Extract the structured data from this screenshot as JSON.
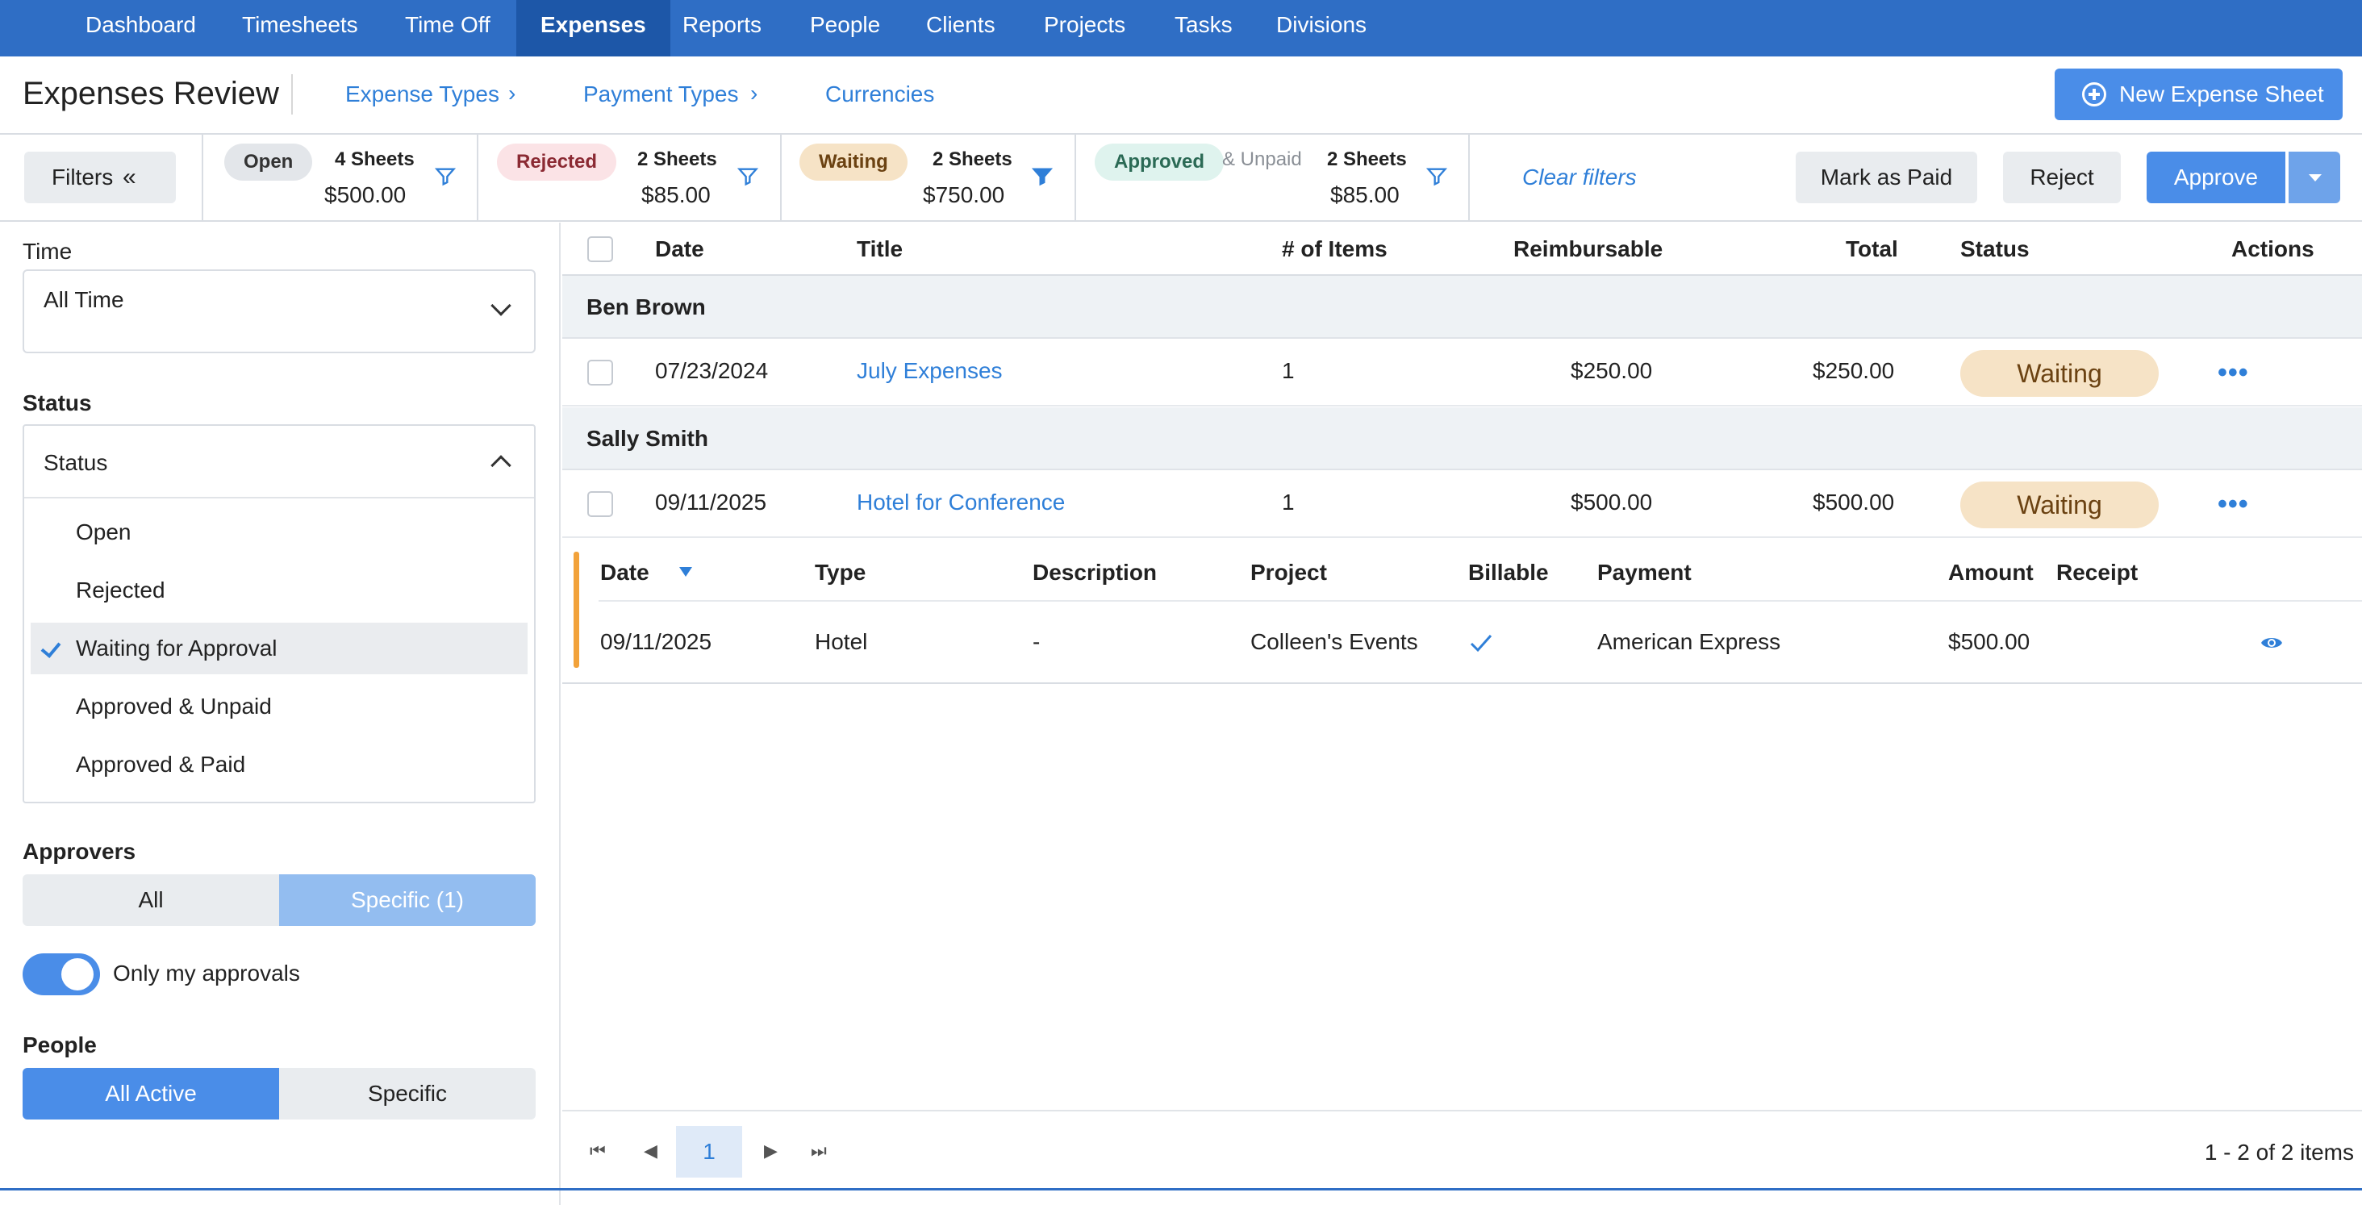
{
  "topnav": {
    "items": [
      "Dashboard",
      "Timesheets",
      "Time Off",
      "Expenses",
      "Reports",
      "People",
      "Clients",
      "Projects",
      "Tasks",
      "Divisions"
    ],
    "active": "Expenses"
  },
  "header": {
    "title": "Expenses Review",
    "links": [
      "Expense Types",
      "Payment Types",
      "Currencies"
    ],
    "new_button": "New Expense Sheet"
  },
  "filterbar": {
    "filters_button": "Filters",
    "summaries": [
      {
        "status": "Open",
        "sheets": "4 Sheets",
        "amount": "$500.00"
      },
      {
        "status": "Rejected",
        "sheets": "2 Sheets",
        "amount": "$85.00"
      },
      {
        "status": "Waiting",
        "sheets": "2 Sheets",
        "amount": "$750.00"
      },
      {
        "status": "Approved",
        "suffix": "& Unpaid",
        "sheets": "2 Sheets",
        "amount": "$85.00"
      }
    ],
    "clear_filters": "Clear filters",
    "mark_paid": "Mark as Paid",
    "reject": "Reject",
    "approve": "Approve"
  },
  "sidebar": {
    "time_label": "Time",
    "time_value": "All Time",
    "status_label": "Status",
    "status_placeholder": "Status",
    "status_options": [
      "Open",
      "Rejected",
      "Waiting for Approval",
      "Approved & Unpaid",
      "Approved & Paid"
    ],
    "status_selected": "Waiting for Approval",
    "approvers_label": "Approvers",
    "approvers_all": "All",
    "approvers_specific": "Specific (1)",
    "only_my_approvals": "Only my approvals",
    "people_label": "People",
    "people_all_active": "All Active",
    "people_specific": "Specific"
  },
  "table": {
    "columns": [
      "Date",
      "Title",
      "# of Items",
      "Reimbursable",
      "Total",
      "Status",
      "Actions"
    ],
    "groups": [
      {
        "name": "Ben Brown",
        "rows": [
          {
            "date": "07/23/2024",
            "title": "July Expenses",
            "items": "1",
            "reimbursable": "$250.00",
            "total": "$250.00",
            "status": "Waiting"
          }
        ]
      },
      {
        "name": "Sally Smith",
        "rows": [
          {
            "date": "09/11/2025",
            "title": "Hotel for Conference",
            "items": "1",
            "reimbursable": "$500.00",
            "total": "$500.00",
            "status": "Waiting"
          }
        ]
      }
    ],
    "detail": {
      "columns": [
        "Date",
        "Type",
        "Description",
        "Project",
        "Billable",
        "Payment",
        "Amount",
        "Receipt"
      ],
      "row": {
        "date": "09/11/2025",
        "type": "Hotel",
        "description": "-",
        "project": "Colleen's Events",
        "payment": "American Express",
        "amount": "$500.00"
      }
    }
  },
  "pager": {
    "current": "1",
    "info": "1 - 2 of 2 items"
  },
  "colors": {
    "brand": "#2f6ec5",
    "accent": "#4a8de8",
    "waiting": "#f6e3c6",
    "link": "#2f7fd8"
  }
}
